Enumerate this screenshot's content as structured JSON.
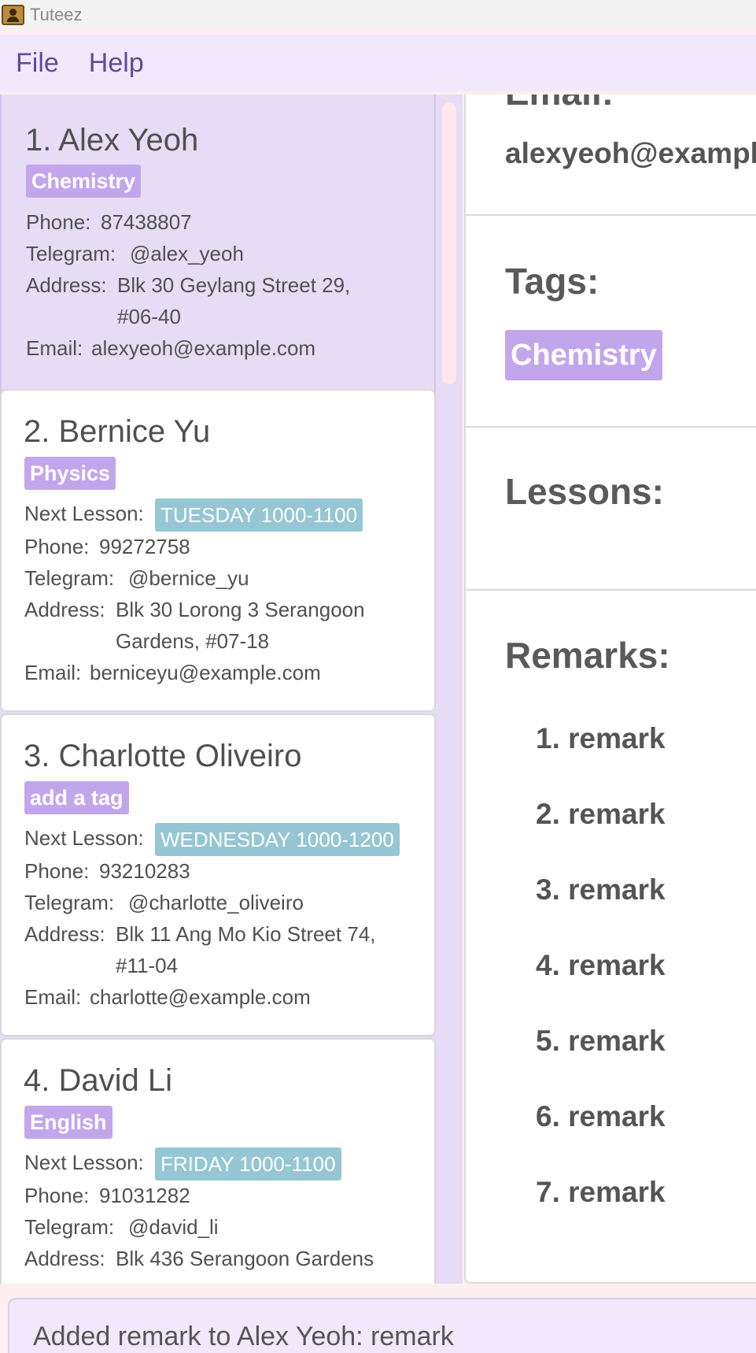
{
  "window": {
    "title": "Tuteez"
  },
  "menu": {
    "file": "File",
    "help": "Help"
  },
  "persons": [
    {
      "name": "1. Alex Yeoh",
      "tag": "Chemistry",
      "phone_label": "Phone:",
      "phone": "87438807",
      "telegram_label": "Telegram:",
      "telegram": "@alex_yeoh",
      "address_label": "Address:",
      "address_line1": "Blk 30 Geylang Street 29,",
      "address_line2": "#06-40",
      "email_label": "Email:",
      "email": "alexyeoh@example.com"
    },
    {
      "name": "2. Bernice Yu",
      "tag": "Physics",
      "lesson_label": "Next Lesson:",
      "lesson": "TUESDAY 1000-1100",
      "phone_label": "Phone:",
      "phone": "99272758",
      "telegram_label": "Telegram:",
      "telegram": "@bernice_yu",
      "address_label": "Address:",
      "address_line1": "Blk 30 Lorong 3 Serangoon",
      "address_line2": "Gardens, #07-18",
      "email_label": "Email:",
      "email": "berniceyu@example.com"
    },
    {
      "name": "3. Charlotte Oliveiro",
      "tag": "add a tag",
      "lesson_label": "Next Lesson:",
      "lesson": "WEDNESDAY 1000-1200",
      "phone_label": "Phone:",
      "phone": "93210283",
      "telegram_label": "Telegram:",
      "telegram": "@charlotte_oliveiro",
      "address_label": "Address:",
      "address_line1": "Blk 11 Ang Mo Kio Street 74,",
      "address_line2": "#11-04",
      "email_label": "Email:",
      "email": "charlotte@example.com"
    },
    {
      "name": "4. David Li",
      "tag": "English",
      "lesson_label": "Next Lesson:",
      "lesson": "FRIDAY 1000-1100",
      "phone_label": "Phone:",
      "phone": "91031282",
      "telegram_label": "Telegram:",
      "telegram": "@david_li",
      "address_label": "Address:",
      "address_line1": "Blk 436 Serangoon Gardens"
    }
  ],
  "detail": {
    "email_heading": "Email:",
    "email": "alexyeoh@example.com",
    "tags_heading": "Tags:",
    "tag": "Chemistry",
    "lessons_heading": "Lessons:",
    "remarks_heading": "Remarks:",
    "remarks": [
      "1. remark",
      "2. remark",
      "3. remark",
      "4. remark",
      "5. remark",
      "6. remark",
      "7. remark"
    ]
  },
  "result": {
    "text": "Added remark to Alex Yeoh: remark"
  },
  "colors": {
    "tag": "#c2a6ec",
    "lesson": "#95c6d3",
    "selected": "#e6dcf5",
    "menu_text": "#5e4a9c"
  }
}
